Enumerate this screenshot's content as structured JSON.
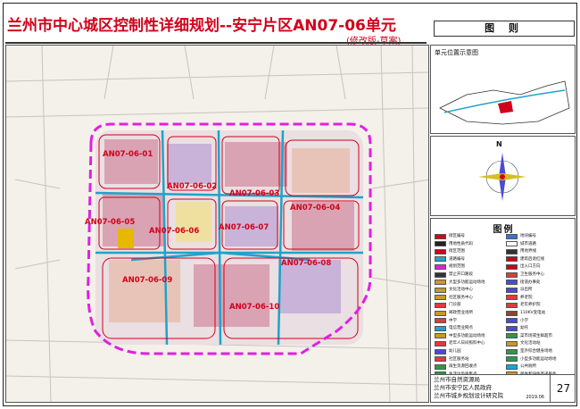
{
  "title": "兰州市中心城区控制性详细规划--安宁片区AN07-06单元",
  "subtitle": "(修改版-草案)",
  "drawing_label": "图  则",
  "inset": {
    "title": "单元位置示意图"
  },
  "north_arrow": {
    "label": "N"
  },
  "map": {
    "unit_labels": [
      "AN07-06-01",
      "AN07-06-02",
      "AN07-06-03",
      "AN07-06-04",
      "AN07-06-05",
      "AN07-06-06",
      "AN07-06-07",
      "AN07-06-08",
      "AN07-06-09",
      "AN07-06-10"
    ]
  },
  "legend": {
    "title": "图例",
    "items": [
      {
        "label": "街区编号",
        "color": "#d0021b"
      },
      {
        "label": "地块编号",
        "color": "#3a6fd8"
      },
      {
        "label": "用地性质代码",
        "color": "#222222"
      },
      {
        "label": "城市道路",
        "color": "#ffffff"
      },
      {
        "label": "街区范围",
        "color": "#d0021b"
      },
      {
        "label": "用地界线",
        "color": "#333333"
      },
      {
        "label": "道路编号",
        "color": "#1fa3c9"
      },
      {
        "label": "建筑后退红线",
        "color": "#d0021b"
      },
      {
        "label": "规划范围",
        "color": "#e020e0"
      },
      {
        "label": "出入口方向",
        "color": "#d0021b"
      },
      {
        "label": "禁止开口路段",
        "color": "#333333"
      },
      {
        "label": "卫生服务中心",
        "color": "#e03a3a"
      },
      {
        "label": "大型多功能运动场地",
        "color": "#c89a2a"
      },
      {
        "label": "街道办事处",
        "color": "#4a4ad8"
      },
      {
        "label": "文化活动中心",
        "color": "#c89a2a"
      },
      {
        "label": "派出所",
        "color": "#4a4ad8"
      },
      {
        "label": "社区服务中心",
        "color": "#c89a2a"
      },
      {
        "label": "养老院",
        "color": "#e03a3a"
      },
      {
        "label": "门诊部",
        "color": "#e03a3a"
      },
      {
        "label": "老年养护院",
        "color": "#e03a3a"
      },
      {
        "label": "邮政营业场所",
        "color": "#c89a2a"
      },
      {
        "label": "110KV变电站",
        "color": "#8a4a2a"
      },
      {
        "label": "中学",
        "color": "#e03a3a"
      },
      {
        "label": "小学",
        "color": "#4a4ad8"
      },
      {
        "label": "电信营业网点",
        "color": "#1fa3c9"
      },
      {
        "label": "幼托",
        "color": "#4a4ad8"
      },
      {
        "label": "中型多功能运动场地",
        "color": "#c89a2a"
      },
      {
        "label": "菜市场或生鲜超市",
        "color": "#2a9a4a"
      },
      {
        "label": "老年人日间照料中心",
        "color": "#e03a3a"
      },
      {
        "label": "文化活动站",
        "color": "#c89a2a"
      },
      {
        "label": "幼儿园",
        "color": "#4a4ad8"
      },
      {
        "label": "室外综合健身场地",
        "color": "#2a9a4a"
      },
      {
        "label": "社区服务站",
        "color": "#e03a3a"
      },
      {
        "label": "小型多功能运动场地",
        "color": "#2a9a4a"
      },
      {
        "label": "再生资源回收点",
        "color": "#2a9a4a"
      },
      {
        "label": "公共厕所",
        "color": "#1fa3c9"
      },
      {
        "label": "生活垃圾收集点",
        "color": "#2a9a4a"
      },
      {
        "label": "邮件和快件寄递服务",
        "color": "#c89a2a"
      },
      {
        "label": "结建地下公共停车场",
        "color": "#d4c020"
      }
    ]
  },
  "footer": {
    "orgs": [
      "兰州市自然资源局",
      "兰州市安宁区人民政府",
      "兰州市城乡规划设计研究院"
    ],
    "date": "2019.06",
    "page": "27"
  },
  "colors": {
    "title_red": "#d0021b",
    "boundary_magenta": "#e020e0",
    "road_cyan": "#1fa3c9"
  }
}
